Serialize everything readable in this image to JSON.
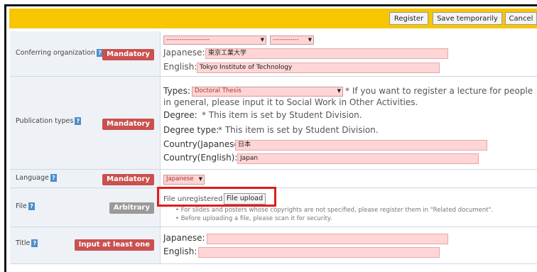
{
  "toolbar": {
    "register": "Register",
    "save": "Save temporarily",
    "cancel": "Cancel"
  },
  "help_glyph": "?",
  "conferring": {
    "label": "Conferring organization",
    "badge": "Mandatory",
    "select1": "--------------------",
    "select2": "------------",
    "japanese_label": "Japanese:",
    "japanese_value": "東京工業大学",
    "english_label": "English:",
    "english_value": "Tokyo Institute of Technology"
  },
  "publication": {
    "label": "Publication types",
    "badge": "Mandatory",
    "types_label": "Types:",
    "types_value": "Doctoral Thesis",
    "types_note_1": "* If you want to register a lecture for people",
    "types_note_2": "in general, please input it to Social Work in Other Activities.",
    "degree_label": "Degree:",
    "degree_note": "* This item is set by Student Division.",
    "degree_type_label": "Degree type:",
    "degree_type_note": "* This item is set by Student Division.",
    "country_jp_label": "Country(Japanese):",
    "country_jp_value": "日本",
    "country_en_label": "Country(English):",
    "country_en_value": "Japan"
  },
  "language": {
    "label": "Language",
    "badge": "Mandatory",
    "value": "Japanese"
  },
  "file": {
    "label": "File",
    "badge": "Arbitrary",
    "status": "File unregistered",
    "upload": "File upload",
    "bullet_1": "For slides and posters whose copyrights are not specified, please register them in \"Related document\".",
    "bullet_2": "Before uploading a file, please scan it for security."
  },
  "title": {
    "label": "Title",
    "badge": "Input at least one",
    "japanese_label": "Japanese:",
    "english_label": "English:"
  },
  "colors": {
    "topbar": "#f7c600",
    "mandatory": "#c9514f",
    "arbitrary": "#9a9a9a",
    "field_bg": "#ffd5d5",
    "highlight": "#e21b1b"
  }
}
